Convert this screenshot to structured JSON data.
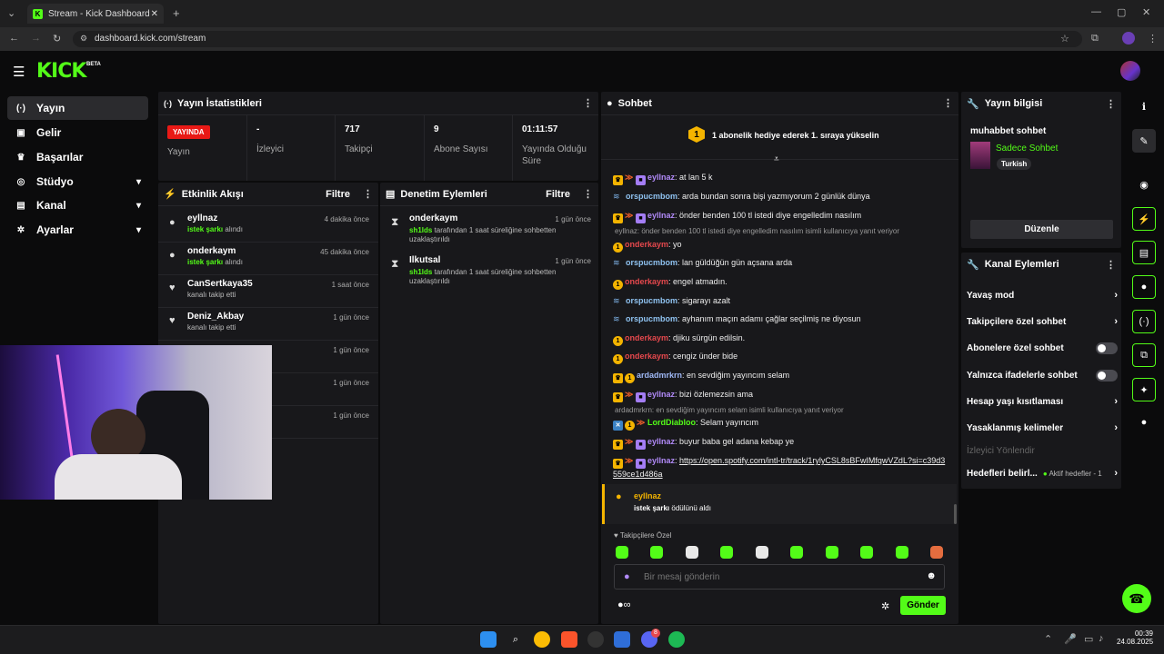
{
  "browser": {
    "tab_title": "Stream - Kick Dashboard",
    "favicon_letter": "K",
    "url": "dashboard.kick.com/stream"
  },
  "brand": {
    "logo": "KICK",
    "beta": "BETA",
    "accent": "#53fc18"
  },
  "nav": [
    {
      "label": "Yayın",
      "icon": "broadcast-icon",
      "glyph": "(·)",
      "active": true
    },
    {
      "label": "Gelir",
      "icon": "wallet-icon",
      "glyph": "▣"
    },
    {
      "label": "Başarılar",
      "icon": "trophy-icon",
      "glyph": "♛"
    },
    {
      "label": "Stüdyo",
      "icon": "studio-icon",
      "glyph": "◎",
      "expand": true
    },
    {
      "label": "Kanal",
      "icon": "channel-icon",
      "glyph": "▤",
      "expand": true
    },
    {
      "label": "Ayarlar",
      "icon": "gear-icon",
      "glyph": "✲",
      "expand": true
    }
  ],
  "stats": {
    "title": "Yayın İstatistikleri",
    "live_badge": "YAYINDA",
    "live_label": "Yayın",
    "viewers_value": "-",
    "viewers_label": "İzleyici",
    "followers_value": "717",
    "followers_label": "Takipçi",
    "subs_value": "9",
    "subs_label": "Abone Sayısı",
    "uptime_value": "01:11:57",
    "uptime_label": "Yayında Olduğu Süre"
  },
  "activity": {
    "title": "Etkinlik Akışı",
    "filter": "Filtre",
    "items": [
      {
        "name": "eyllnaz",
        "reward": "istek şarkı",
        "suffix": " alındı",
        "time": "4 dakika önce",
        "icon": "redeem"
      },
      {
        "name": "onderkaym",
        "reward": "istek şarkı",
        "suffix": " alındı",
        "time": "45 dakika önce",
        "icon": "redeem"
      },
      {
        "name": "CanSertkaya35",
        "reward": "",
        "suffix": "kanalı takip etti",
        "time": "1 saat önce",
        "icon": "heart"
      },
      {
        "name": "Deniz_Akbay",
        "reward": "",
        "suffix": "kanalı takip etti",
        "time": "1 gün önce",
        "icon": "heart"
      }
    ],
    "hidden_times": [
      "1 gün önce",
      "1 gün önce",
      "1 gün önce"
    ]
  },
  "moderation": {
    "title": "Denetim Eylemleri",
    "filter": "Filtre",
    "items": [
      {
        "name": "onderkaym",
        "actor": "sh1lds",
        "text": " tarafından 1 saat süreliğine sohbetten uzaklaştırıldı",
        "time": "1 gün önce"
      },
      {
        "name": "Ilkutsal",
        "actor": "sh1lds",
        "text": " tarafından 1 saat süreliğine sohbetten uzaklaştırıldı",
        "time": "1 gün önce"
      }
    ]
  },
  "chat": {
    "title": "Sohbet",
    "pinned_badge": "1",
    "pinned_text": "1 abonelik hediye ederek 1. sıraya yükselin",
    "messages": [
      {
        "badges": "crown,arrow,purp",
        "user": "eyllnaz",
        "color": "#b18af8",
        "text": "at lan 5 k"
      },
      {
        "badges": "rsk",
        "user": "orspucmbom",
        "color": "#8fc2f0",
        "text": "arda bundan sonra bişi yazmıyorum 2 günlük dünya"
      },
      {
        "badges": "crown,arrow,purp",
        "user": "eyllnaz",
        "color": "#b18af8",
        "text": "önder benden 100 tl istedi diye engelledim nasılım"
      },
      {
        "reply": "eyllnaz: önder benden 100 tl istedi diye engelledim nasılım isimli kullanıcıya yanıt veriyor"
      },
      {
        "badges": "sub1",
        "user": "onderkaym",
        "color": "#e5484d",
        "text": "yo"
      },
      {
        "badges": "rsk",
        "user": "orspucmbom",
        "color": "#8fc2f0",
        "text": "lan güldüğün gün açsana arda"
      },
      {
        "badges": "sub1",
        "user": "onderkaym",
        "color": "#e5484d",
        "text": "engel atmadın."
      },
      {
        "badges": "rsk",
        "user": "orspucmbom",
        "color": "#8fc2f0",
        "text": "sigarayı azalt"
      },
      {
        "badges": "rsk",
        "user": "orspucmbom",
        "color": "#8fc2f0",
        "text": "ayhanım maçın adamı çağlar seçilmiş ne diyosun"
      },
      {
        "badges": "sub1",
        "user": "onderkaym",
        "color": "#e5484d",
        "text": "djiku sürgün edilsin."
      },
      {
        "badges": "sub1",
        "user": "onderkaym",
        "color": "#e5484d",
        "text": "cengiz ünder bide"
      },
      {
        "badges": "crown,sub1",
        "user": "ardadmrkrn",
        "color": "#9fb8f5",
        "text": "en sevdiğim yayıncım selam"
      },
      {
        "badges": "crown,arrow,purp",
        "user": "eyllnaz",
        "color": "#b18af8",
        "text": "bizi özlemezsin ama"
      },
      {
        "reply": "ardadmrkrn: en sevdiğim yayıncım selam isimli kullanıcıya yanıt veriyor"
      },
      {
        "badges": "blue,sub1,arrow",
        "user": "LordDiabloo",
        "color": "#53fc18",
        "text": "Selam yayıncım"
      },
      {
        "badges": "crown,arrow,purp",
        "user": "eyllnaz",
        "color": "#b18af8",
        "text": "buyur baba gel adana kebap ye"
      },
      {
        "badges": "crown,arrow,purp",
        "user": "eyllnaz",
        "color": "#b18af8",
        "link": "https://open.spotify.com/intl-tr/track/1rylyCSL8sBFwIMfqwVZdL?si=c39d3559ce1d486a"
      }
    ],
    "redeem_user": "eyllnaz",
    "redeem_reward": "istek şarkı",
    "redeem_suffix": " ödülünü aldı",
    "emote_tab": "Takipçilere Özel",
    "input_placeholder": "Bir mesaj gönderin",
    "send_label": "Gönder"
  },
  "stream_info": {
    "title": "Yayın bilgisi",
    "stream_title": "muhabbet sohbet",
    "category": "Sadece Sohbet",
    "language": "Turkish",
    "edit_label": "Düzenle"
  },
  "channel_actions": {
    "title": "Kanal Eylemleri",
    "slow_mode": "Yavaş mod",
    "follower_chat": "Takipçilere özel sohbet",
    "sub_chat": "Abonelere özel sohbet",
    "emote_chat": "Yalnızca ifadelerle sohbet",
    "account_age": "Hesap yaşı kısıtlaması",
    "banned_words": "Yasaklanmış kelimeler",
    "host": "İzleyici Yönlendir",
    "goals": "Hedefleri belirl...",
    "goals_status": "Aktif hedefler - 1"
  },
  "taskbar": {
    "time": "00:39",
    "date": "24.08.2025",
    "notif_count": "8"
  }
}
